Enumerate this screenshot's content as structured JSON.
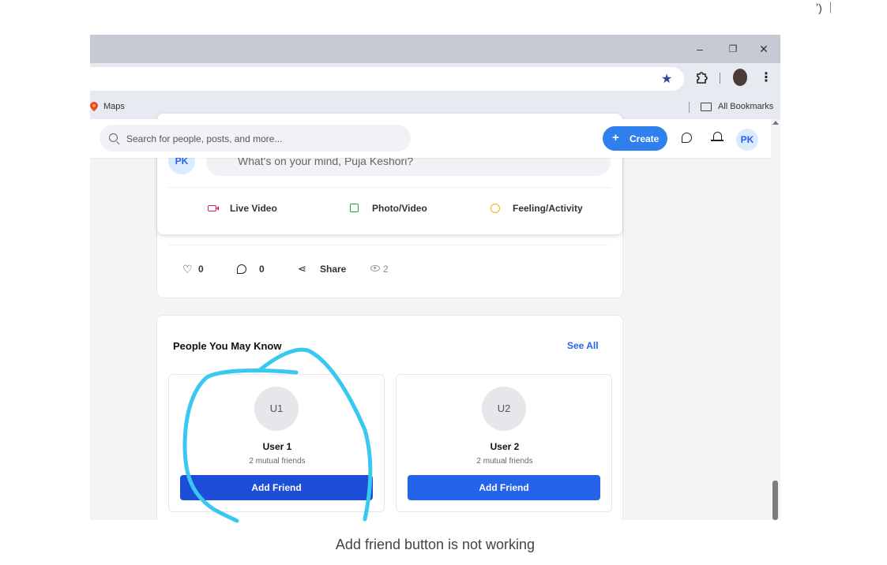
{
  "browser": {
    "window_controls": {
      "minimize": "–",
      "restore": "❐",
      "close": "✕"
    },
    "bookmarks": {
      "maps": "Maps",
      "all_bookmarks": "All Bookmarks"
    }
  },
  "header": {
    "search_placeholder": "Search for people, posts, and more...",
    "create_label": "Create",
    "avatar_initials": "PK"
  },
  "composer": {
    "avatar_initials": "PK",
    "placeholder": "What's on your mind, Puja Keshori?",
    "actions": [
      {
        "label": "Live Video",
        "icon": "video-icon",
        "color": "#e11d48"
      },
      {
        "label": "Photo/Video",
        "icon": "photo-icon",
        "color": "#16a34a"
      },
      {
        "label": "Feeling/Activity",
        "icon": "smile-icon",
        "color": "#eab308"
      }
    ]
  },
  "post_stats": {
    "likes": "0",
    "comments": "0",
    "share_label": "Share",
    "views": "2"
  },
  "people": {
    "title": "People You May Know",
    "see_all": "See All",
    "items": [
      {
        "initials": "U1",
        "name": "User 1",
        "mutual": "2 mutual friends",
        "button": "Add Friend",
        "button_color": "#1d4ed8"
      },
      {
        "initials": "U2",
        "name": "User 2",
        "mutual": "2 mutual friends",
        "button": "Add Friend",
        "button_color": "#2563eb"
      }
    ]
  },
  "caption": "Add friend button is not working",
  "colors": {
    "accent": "#2f80ed",
    "annotation": "#38c8f0"
  }
}
